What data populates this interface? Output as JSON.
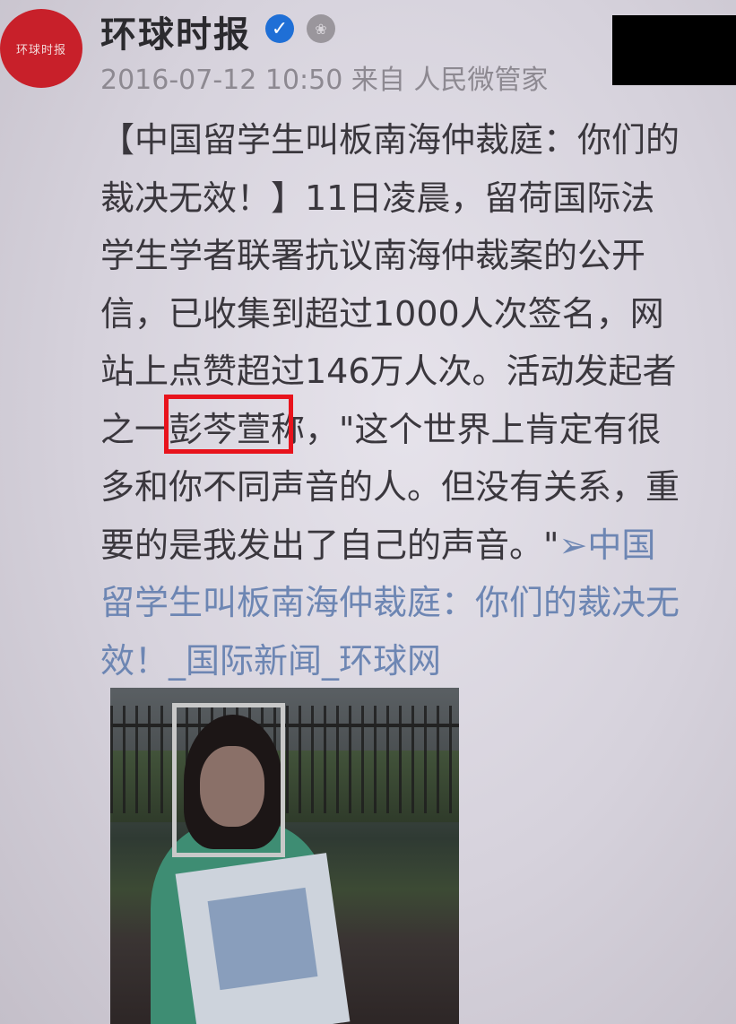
{
  "post": {
    "avatar_text": "环球时报",
    "author": "环球时报",
    "verified_icon": "verified-badge-icon",
    "medal_icon": "medal-icon",
    "meta": "2016-07-12 10:50 来自 人民微管家",
    "lines": [
      "【中国留学生叫板南海仲裁庭：你们的",
      "裁决无效！】11日凌晨，留荷国际法",
      "学生学者联署抗议南海仲裁案的公开",
      "信，已收集到超过1000人次签名，网",
      "站上点赞超过146万人次。活动发起者",
      "之一彭芩萱称，\"这个世界上肯定有很",
      "多和你不同声音的人。但没有关系，重",
      "要的是我发出了自己的声音。\""
    ],
    "link_arrow": "➢",
    "link_lines": [
      "中国",
      "留学生叫板南海仲裁庭：你们的裁决无",
      "效！_国际新闻_环球网"
    ]
  },
  "colors": {
    "avatar_bg": "#c8202a",
    "verified": "#1f6fd6",
    "link": "#6d86b3",
    "highlight_box": "#e8131c",
    "face_box": "#c9c9c9",
    "redaction": "#000000"
  }
}
